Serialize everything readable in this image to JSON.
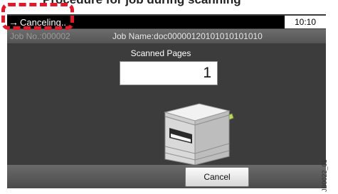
{
  "heading": {
    "text": "Procedure for job during scanning"
  },
  "status_bar": {
    "state": "Canceling..",
    "time": "10:10"
  },
  "job_bar": {
    "job_no": "Job No.:000002",
    "job_name": "Job Name:doc00000120101010101010"
  },
  "scan": {
    "label": "Scanned Pages",
    "count": "1"
  },
  "actions": {
    "cancel": "Cancel"
  },
  "figure_code": "JB0022_01",
  "colors": {
    "callout": "#e0192b",
    "screen_bg": "#3c3c3c"
  }
}
